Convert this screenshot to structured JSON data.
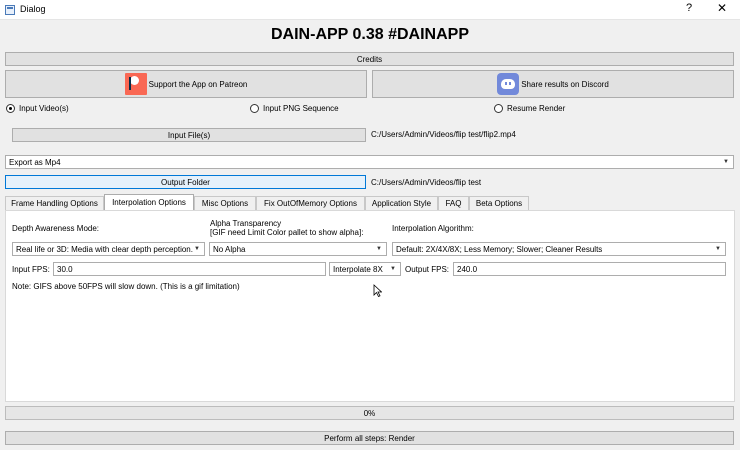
{
  "window": {
    "title": "Dialog",
    "help": "?",
    "close": "✕"
  },
  "heading": "DAIN-APP 0.38 #DAINAPP",
  "credits_label": "Credits",
  "patreon_label": "Support the App on Patreon",
  "discord_label": "Share results on Discord",
  "input_mode": {
    "options": [
      "Input Video(s)",
      "Input PNG Sequence",
      "Resume Render"
    ],
    "selected": "Input Video(s)"
  },
  "input_files": {
    "button": "Input File(s)",
    "path": "C:/Users/Admin/Videos/flip test/flip2.mp4"
  },
  "export_select": "Export as Mp4",
  "output_folder": {
    "button": "Output Folder",
    "path": "C:/Users/Admin/Videos/flip test"
  },
  "tabs": [
    "Frame Handling Options",
    "Interpolation Options",
    "Misc Options",
    "Fix OutOfMemory Options",
    "Application Style",
    "FAQ",
    "Beta Options"
  ],
  "active_tab": "Interpolation Options",
  "interp": {
    "depth_label": "Depth Awareness Mode:",
    "depth_value": "Real life or 3D: Media with clear depth perception.",
    "alpha_label_1": "Alpha Transparency",
    "alpha_label_2": "[GIF need Limit Color pallet to show alpha]:",
    "alpha_value": "No Alpha",
    "algo_label": "Interpolation Algorithm:",
    "algo_value": "Default: 2X/4X/8X; Less Memory; Slower; Cleaner Results",
    "input_fps_label": "Input FPS:",
    "input_fps_value": "30.0",
    "interp_select": "Interpolate 8X",
    "output_fps_label": "Output FPS:",
    "output_fps_value": "240.0",
    "note": "Note: GIFS above 50FPS will slow down. (This is a gif limitation)"
  },
  "progress": {
    "value": 0,
    "label": "0%"
  },
  "perform_label": "Perform all steps: Render"
}
